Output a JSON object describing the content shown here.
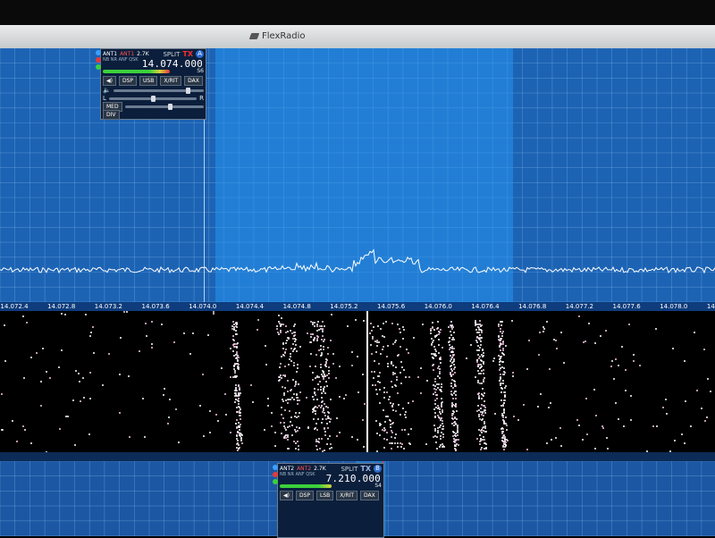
{
  "window": {
    "title": "FlexRadio"
  },
  "panadapter": {
    "freq_ticks": [
      "14.072.4",
      "14.072.8",
      "14.073.2",
      "14.073.6",
      "14.074.0",
      "14.074.4",
      "14.074.8",
      "14.075.2",
      "14.075.6",
      "14.076.0",
      "14.076.4",
      "14.076.8",
      "14.077.2",
      "14.077.6",
      "14.078.0",
      "14.078.4"
    ],
    "colors": {
      "background": "#1c63b4",
      "filter": "#2b96f0",
      "trace": "#ffffff"
    }
  },
  "slice_a": {
    "ant_rx": "ANT1",
    "ant_tx": "ANT1",
    "bandwidth": "2.7K",
    "sub_label": "NB NR ANF QSK",
    "split": "SPLIT",
    "tx": "TX",
    "letter": "A",
    "frequency": "14.074.000",
    "smeter": "S6",
    "buttons": [
      "DSP",
      "USB",
      "X/RIT",
      "DAX"
    ],
    "pan_left": "L",
    "pan_right": "R",
    "agc_mode": "MED",
    "div": "DIV"
  },
  "slice_b": {
    "ant_rx": "ANT2",
    "ant_tx": "ANT2",
    "bandwidth": "2.7K",
    "sub_label": "NB NR ANF QSK",
    "split": "SPLIT",
    "tx": "TX",
    "letter": "B",
    "frequency": "7.210.000",
    "smeter": "S4",
    "buttons": [
      "DSP",
      "LSB",
      "X/RIT",
      "DAX"
    ]
  },
  "icons": [
    "flex-logo-icon",
    "speaker-icon",
    "lock-icon"
  ]
}
